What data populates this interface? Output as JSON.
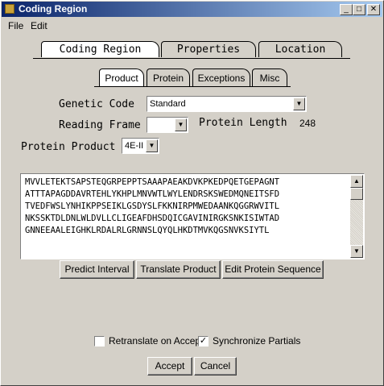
{
  "window": {
    "title": "Coding Region",
    "minimize": "_",
    "maximize": "□",
    "close": "✕"
  },
  "menu": {
    "file": "File",
    "edit": "Edit"
  },
  "tabs": {
    "main": [
      "Coding Region",
      "Properties",
      "Location"
    ],
    "sub": [
      "Product",
      "Protein",
      "Exceptions",
      "Misc"
    ]
  },
  "form": {
    "genetic_code_label": "Genetic Code",
    "genetic_code_value": "Standard",
    "reading_frame_label": "Reading Frame",
    "reading_frame_value": "",
    "protein_length_label": "Protein Length",
    "protein_length_value": "248",
    "protein_product_label": "Protein Product",
    "protein_product_value": "4E-II"
  },
  "sequence": "MVVLETEKTSAPSTEQGRPEPPTSAAAPAEAKDVKPKEDPQETGEPAGNT\nATTTAPAGDDAVRTEHLYKHPLMNVWTLWYLENDRSKSWEDMQNEITSFD\nTVEDFWSLYNHIKPPSEIKLGSDYSLFKKNIRPMWEDAANKQGGRWVITL\nNKSSKTDLDNLWLDVLLCLIGEAFDHSDQICGAVINIRGKSNKISIWTAD\nGNNEEAALEIGHKLRDALRLGRNNSLQYQLHKDTMVKQGSNVKSIYTL",
  "buttons": {
    "predict_interval": "Predict Interval",
    "translate_product": "Translate Product",
    "edit_protein_sequence": "Edit Protein Sequence",
    "accept": "Accept",
    "cancel": "Cancel"
  },
  "options": {
    "retranslate_label": "Retranslate on Accept",
    "retranslate_checked": false,
    "sync_label": "Synchronize Partials",
    "sync_checked": true,
    "check_mark": "✓"
  }
}
